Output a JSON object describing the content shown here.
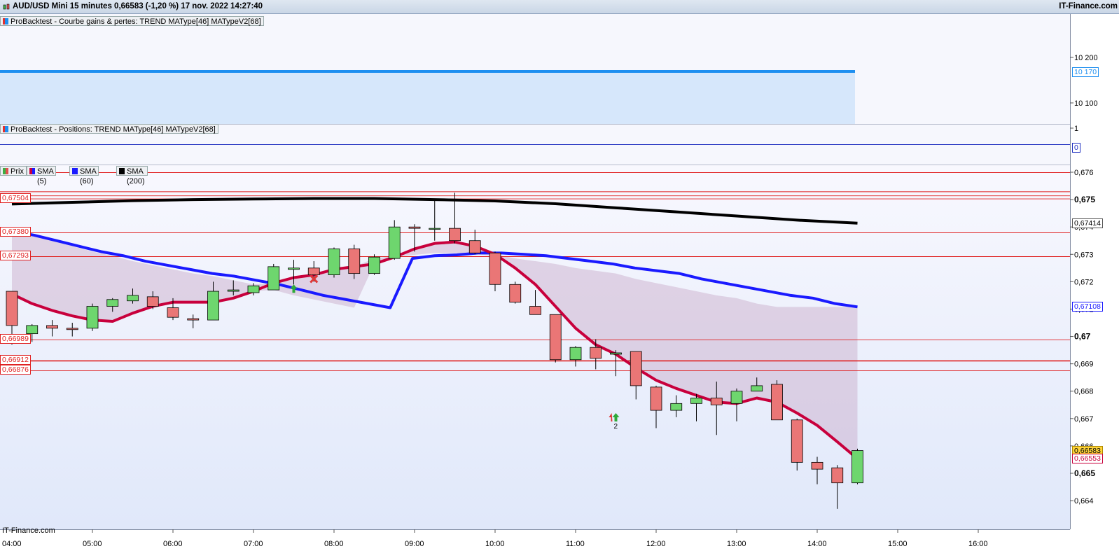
{
  "header": {
    "title": "AUD/USD Mini 15 minutes 0,66583 (-1,20 %) 17 nov. 2022 14:27:40",
    "brand": "IT-Finance.com"
  },
  "panels": {
    "equity_legend": "ProBacktest - Courbe gains & pertes: TREND MAType[46] MATypeV2[68]",
    "equity_ticks": [
      "10 200",
      "10 100"
    ],
    "equity_last": "10 170",
    "positions_legend": "ProBacktest - Positions: TREND MAType[46] MATypeV2[68]",
    "positions_ticks": [
      "1"
    ],
    "positions_last": "0",
    "price_legends": [
      {
        "label": "Prix",
        "color": "#3cb043"
      },
      {
        "label": "SMA (5)",
        "color": "#c0003c"
      },
      {
        "label": "SMA (60)",
        "color": "#1a1aff"
      },
      {
        "label": "SMA (200)",
        "color": "#000000"
      }
    ],
    "watermark": "IT-Finance.com"
  },
  "price_axis": {
    "ticks": [
      "0,676",
      "0,675",
      "0,674",
      "0,673",
      "0,672",
      "0,671",
      "0,67",
      "0,669",
      "0,668",
      "0,667",
      "0,666",
      "0,665",
      "0,664"
    ],
    "bold_ticks": [
      "0,675",
      "0,67",
      "0,665"
    ],
    "tags": [
      {
        "text": "0,67414",
        "kind": "sma200"
      },
      {
        "text": "0,67108",
        "kind": "sma60"
      },
      {
        "text": "0,66583",
        "kind": "last"
      },
      {
        "text": "0,66553",
        "kind": "sma5"
      }
    ]
  },
  "level_labels": [
    "0,67504",
    "0,67380",
    "0,67293",
    "0,66989",
    "0,66912",
    "0,66876"
  ],
  "trade_marks": [
    {
      "type": "buy-arrow",
      "time": "07:30"
    },
    {
      "type": "exit-cross",
      "time": "07:45"
    },
    {
      "type": "buy-arrow",
      "time": "11:30",
      "count": "2"
    }
  ],
  "chart_data": {
    "type": "candlestick",
    "title": "AUD/USD Mini 15 minutes",
    "x_ticks": [
      "04:00",
      "05:00",
      "06:00",
      "07:00",
      "08:00",
      "09:00",
      "10:00",
      "11:00",
      "12:00",
      "13:00",
      "14:00",
      "15:00",
      "16:00"
    ],
    "ylim": [
      0.6637,
      0.6764
    ],
    "horizontal_levels": [
      0.676,
      0.6753,
      0.67515,
      0.67504,
      0.6738,
      0.67293,
      0.66989,
      0.66912,
      0.66876
    ],
    "candles": [
      {
        "t": "04:00",
        "o": 0.67165,
        "h": 0.67165,
        "l": 0.6697,
        "c": 0.6704
      },
      {
        "t": "04:15",
        "o": 0.6701,
        "h": 0.67045,
        "l": 0.6698,
        "c": 0.6704
      },
      {
        "t": "04:30",
        "o": 0.6704,
        "h": 0.6706,
        "l": 0.67,
        "c": 0.6703
      },
      {
        "t": "04:45",
        "o": 0.6703,
        "h": 0.6705,
        "l": 0.67,
        "c": 0.67025
      },
      {
        "t": "05:00",
        "o": 0.6703,
        "h": 0.6712,
        "l": 0.6702,
        "c": 0.6711
      },
      {
        "t": "05:15",
        "o": 0.6711,
        "h": 0.6714,
        "l": 0.6709,
        "c": 0.67135
      },
      {
        "t": "05:30",
        "o": 0.6713,
        "h": 0.67175,
        "l": 0.6712,
        "c": 0.6715
      },
      {
        "t": "05:45",
        "o": 0.67145,
        "h": 0.67165,
        "l": 0.671,
        "c": 0.6711
      },
      {
        "t": "06:00",
        "o": 0.67105,
        "h": 0.6714,
        "l": 0.6706,
        "c": 0.6707
      },
      {
        "t": "06:15",
        "o": 0.67065,
        "h": 0.6708,
        "l": 0.6703,
        "c": 0.6706
      },
      {
        "t": "06:30",
        "o": 0.6706,
        "h": 0.672,
        "l": 0.6706,
        "c": 0.67165
      },
      {
        "t": "06:45",
        "o": 0.67165,
        "h": 0.67205,
        "l": 0.6715,
        "c": 0.6717
      },
      {
        "t": "07:00",
        "o": 0.6716,
        "h": 0.67195,
        "l": 0.6715,
        "c": 0.67185
      },
      {
        "t": "07:15",
        "o": 0.6717,
        "h": 0.67265,
        "l": 0.6717,
        "c": 0.67255
      },
      {
        "t": "07:30",
        "o": 0.67245,
        "h": 0.6728,
        "l": 0.6719,
        "c": 0.6725
      },
      {
        "t": "07:45",
        "o": 0.6725,
        "h": 0.67275,
        "l": 0.672,
        "c": 0.67225
      },
      {
        "t": "08:00",
        "o": 0.67225,
        "h": 0.67325,
        "l": 0.67215,
        "c": 0.6732
      },
      {
        "t": "08:15",
        "o": 0.6732,
        "h": 0.67335,
        "l": 0.6721,
        "c": 0.6723
      },
      {
        "t": "08:30",
        "o": 0.6723,
        "h": 0.673,
        "l": 0.67225,
        "c": 0.6729
      },
      {
        "t": "08:45",
        "o": 0.67285,
        "h": 0.67425,
        "l": 0.6728,
        "c": 0.674
      },
      {
        "t": "09:00",
        "o": 0.674,
        "h": 0.6741,
        "l": 0.6731,
        "c": 0.67395
      },
      {
        "t": "09:15",
        "o": 0.67395,
        "h": 0.675,
        "l": 0.6735,
        "c": 0.67395
      },
      {
        "t": "09:30",
        "o": 0.67395,
        "h": 0.67525,
        "l": 0.6734,
        "c": 0.6735
      },
      {
        "t": "09:45",
        "o": 0.6735,
        "h": 0.6739,
        "l": 0.673,
        "c": 0.67305
      },
      {
        "t": "10:00",
        "o": 0.67305,
        "h": 0.6731,
        "l": 0.67165,
        "c": 0.6719
      },
      {
        "t": "10:15",
        "o": 0.6719,
        "h": 0.672,
        "l": 0.6712,
        "c": 0.67125
      },
      {
        "t": "10:30",
        "o": 0.6711,
        "h": 0.6717,
        "l": 0.6708,
        "c": 0.6708
      },
      {
        "t": "10:45",
        "o": 0.6708,
        "h": 0.6708,
        "l": 0.66905,
        "c": 0.66915
      },
      {
        "t": "11:00",
        "o": 0.66915,
        "h": 0.66965,
        "l": 0.6689,
        "c": 0.6696
      },
      {
        "t": "11:15",
        "o": 0.6696,
        "h": 0.6699,
        "l": 0.6688,
        "c": 0.6692
      },
      {
        "t": "11:30",
        "o": 0.66935,
        "h": 0.6695,
        "l": 0.66855,
        "c": 0.6694
      },
      {
        "t": "11:45",
        "o": 0.66945,
        "h": 0.66945,
        "l": 0.6677,
        "c": 0.6682
      },
      {
        "t": "12:00",
        "o": 0.66815,
        "h": 0.6682,
        "l": 0.66665,
        "c": 0.6673
      },
      {
        "t": "12:15",
        "o": 0.6673,
        "h": 0.66785,
        "l": 0.66705,
        "c": 0.66755
      },
      {
        "t": "12:30",
        "o": 0.66755,
        "h": 0.6679,
        "l": 0.6669,
        "c": 0.66775
      },
      {
        "t": "12:45",
        "o": 0.66775,
        "h": 0.66835,
        "l": 0.6664,
        "c": 0.6675
      },
      {
        "t": "13:00",
        "o": 0.66755,
        "h": 0.6681,
        "l": 0.6669,
        "c": 0.668
      },
      {
        "t": "13:15",
        "o": 0.668,
        "h": 0.6685,
        "l": 0.668,
        "c": 0.6682
      },
      {
        "t": "13:30",
        "o": 0.66825,
        "h": 0.6684,
        "l": 0.667,
        "c": 0.66695
      },
      {
        "t": "13:45",
        "o": 0.66695,
        "h": 0.667,
        "l": 0.6651,
        "c": 0.6654
      },
      {
        "t": "14:00",
        "o": 0.6654,
        "h": 0.6656,
        "l": 0.6646,
        "c": 0.66515
      },
      {
        "t": "14:15",
        "o": 0.6652,
        "h": 0.6653,
        "l": 0.6637,
        "c": 0.66465
      },
      {
        "t": "14:30",
        "o": 0.66465,
        "h": 0.6659,
        "l": 0.6646,
        "c": 0.66583
      }
    ],
    "series": [
      {
        "name": "SMA (5)",
        "color": "#c8003c",
        "values": [
          0.67155,
          0.6712,
          0.67095,
          0.67075,
          0.6706,
          0.67055,
          0.67085,
          0.6711,
          0.67125,
          0.67125,
          0.67125,
          0.6714,
          0.67165,
          0.67195,
          0.67215,
          0.67225,
          0.67245,
          0.67255,
          0.67265,
          0.6729,
          0.6732,
          0.6734,
          0.67345,
          0.6733,
          0.673,
          0.6725,
          0.6719,
          0.6711,
          0.6703,
          0.6697,
          0.66935,
          0.66885,
          0.6684,
          0.6681,
          0.66785,
          0.6676,
          0.66755,
          0.66775,
          0.6676,
          0.6672,
          0.66675,
          0.66615,
          0.66553
        ]
      },
      {
        "name": "SMA (60)",
        "color": "#1a1aff",
        "values": [
          0.67385,
          0.6737,
          0.6735,
          0.6733,
          0.6731,
          0.67295,
          0.67275,
          0.6726,
          0.67245,
          0.6723,
          0.6722,
          0.67205,
          0.6719,
          0.6717,
          0.6715,
          0.67135,
          0.6712,
          0.67105,
          0.67285,
          0.67295,
          0.67298,
          0.67305,
          0.67305,
          0.673,
          0.67295,
          0.67285,
          0.67275,
          0.67265,
          0.6725,
          0.6724,
          0.6723,
          0.6721,
          0.67195,
          0.6718,
          0.67165,
          0.6715,
          0.6714,
          0.6712,
          0.67108
        ]
      },
      {
        "name": "SMA (200)",
        "color": "#000000",
        "values": [
          0.67484,
          0.6749,
          0.67496,
          0.675,
          0.67502,
          0.67504,
          0.67504,
          0.675,
          0.67495,
          0.67485,
          0.6747,
          0.67455,
          0.6744,
          0.67425,
          0.67414
        ]
      }
    ]
  }
}
